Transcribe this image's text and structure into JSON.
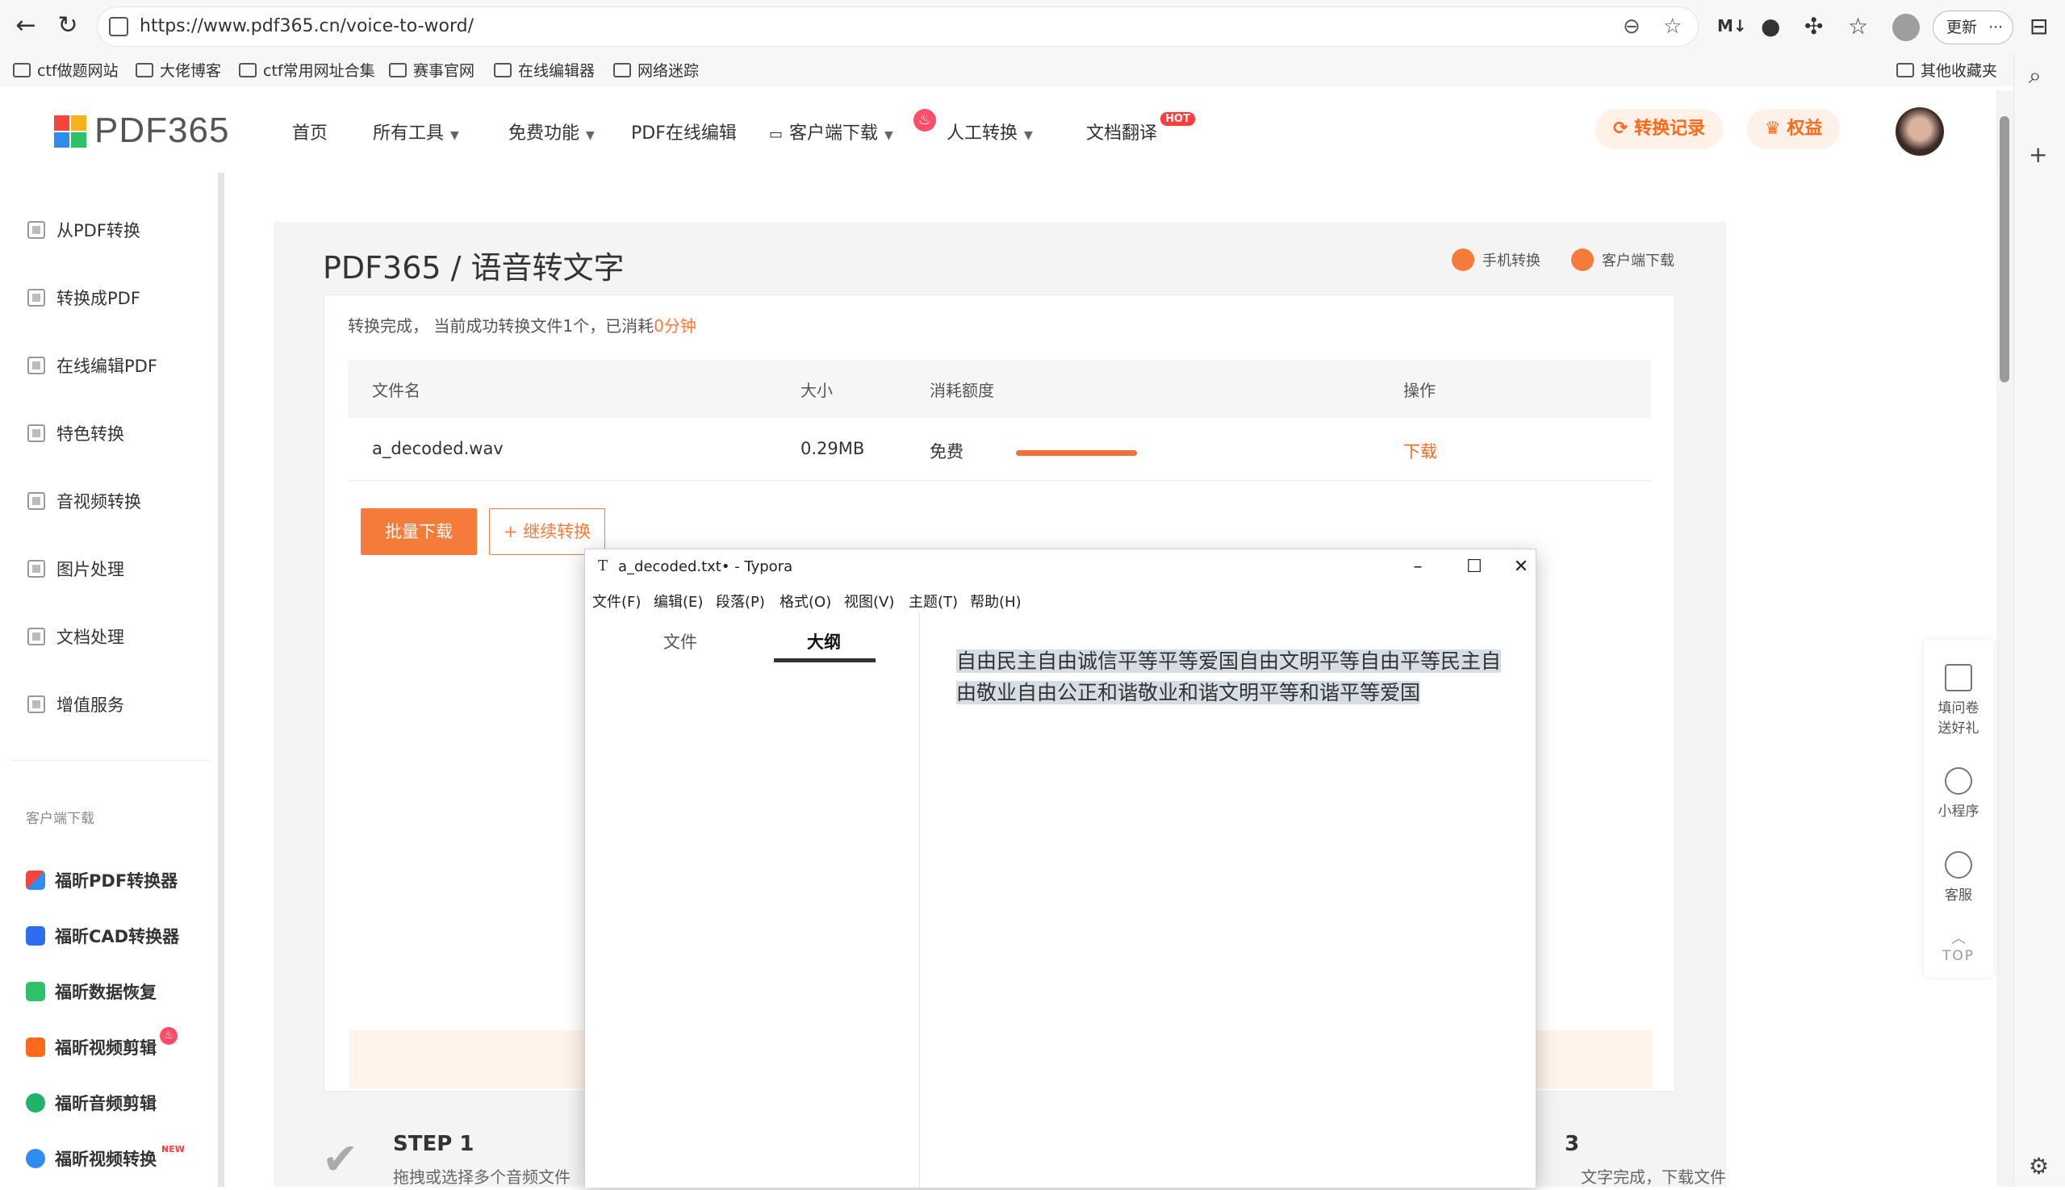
{
  "browser": {
    "url": "https://www.pdf365.cn/voice-to-word/",
    "update_label": "更新",
    "more_label": "···",
    "bookmarks": [
      "ctf做题网站",
      "大佬博客",
      "ctf常用网址合集",
      "赛事官网",
      "在线编辑器",
      "网络迷踪"
    ],
    "other_bookmarks": "其他收藏夹"
  },
  "site": {
    "logo_text": "PDF365",
    "nav": {
      "home": "首页",
      "all_tools": "所有工具",
      "free": "免费功能",
      "online_edit": "PDF在线编辑",
      "client_download": "客户端下载",
      "manual": "人工转换",
      "translate": "文档翻译",
      "hot_badge": "HOT"
    },
    "records_label": "转换记录",
    "benefits_label": "权益"
  },
  "sidebar": {
    "items": [
      "从PDF转换",
      "转换成PDF",
      "在线编辑PDF",
      "特色转换",
      "音视频转换",
      "图片处理",
      "文档处理",
      "增值服务"
    ],
    "client_title": "客户端下载",
    "apps": [
      "福昕PDF转换器",
      "福昕CAD转换器",
      "福昕数据恢复",
      "福昕视频剪辑",
      "福昕音频剪辑",
      "福昕视频转换"
    ],
    "new_tag": "NEW"
  },
  "main": {
    "title": "PDF365 / 语音转文字",
    "mobile_convert": "手机转换",
    "client_download": "客户端下载",
    "status_prefix": "转换完成， 当前成功转换文件1个，已消耗",
    "status_time": "0分钟",
    "table": {
      "headers": [
        "文件名",
        "大小",
        "消耗额度",
        "操作"
      ],
      "row": {
        "filename": "a_decoded.wav",
        "size": "0.29MB",
        "quota": "免费",
        "progress": 1.0,
        "action": "下载"
      }
    },
    "batch_download": "批量下载",
    "continue_convert": "继续转换",
    "step1_title": "STEP 1",
    "step1_desc": "拖拽或选择多个音频文件",
    "step3_num": "3",
    "step3_desc": "文字完成，下载文件"
  },
  "floatbar": {
    "survey": [
      "填问卷",
      "送好礼"
    ],
    "miniprogram": "小程序",
    "service": "客服",
    "top": "TOP"
  },
  "typora": {
    "app_icon": "T",
    "title": "a_decoded.txt• - Typora",
    "menus": [
      "文件(F)",
      "编辑(E)",
      "段落(P)",
      "格式(O)",
      "视图(V)",
      "主题(T)",
      "帮助(H)"
    ],
    "tab_files": "文件",
    "tab_outline": "大纲",
    "content": "自由民主自由诚信平等平等爱国自由文明平等自由平等民主自由敬业自由公正和谐敬业和谐文明平等和谐平等爱国"
  }
}
